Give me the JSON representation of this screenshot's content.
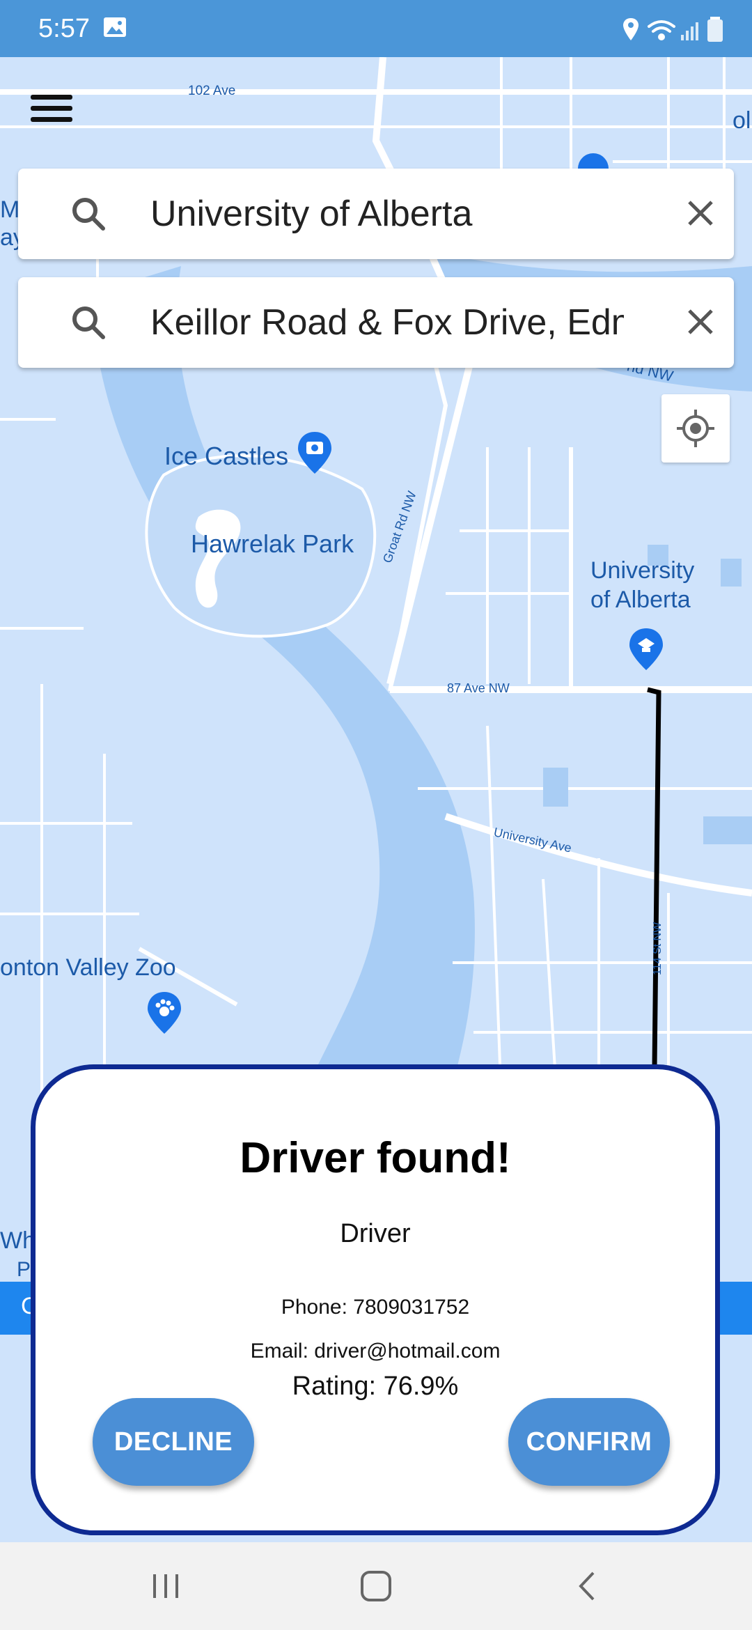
{
  "status_bar": {
    "time": "5:57"
  },
  "map": {
    "labels": {
      "ave102": "102 Ave",
      "ice_castles": "Ice Castles",
      "hawrelak_park": "Hawrelak Park",
      "groat_rd": "Groat Rd NW",
      "university_l1": "University",
      "university_l2": "of Alberta",
      "ave87": "87 Ave NW",
      "university_ave": "University Ave",
      "st114": "114 St NW",
      "valley_zoo": "onton Valley Zoo",
      "frag_ma": "Ma",
      "frag_ay": "ay",
      "frag_ol": "ol",
      "frag_nd": "nd NW",
      "frag_whi": "Whi",
      "frag_p": "P",
      "frag_c": "C"
    }
  },
  "search": {
    "origin": {
      "value": "University of Alberta"
    },
    "destination": {
      "value": "Keillor Road & Fox Drive, Edmonton"
    }
  },
  "dialog": {
    "title": "Driver found!",
    "driver_name": "Driver",
    "phone": "Phone: 7809031752",
    "email": "Email: driver@hotmail.com",
    "rating": "Rating: 76.9%",
    "decline_label": "DECLINE",
    "confirm_label": "CONFIRM"
  },
  "colors": {
    "status_bar": "#4b96d8",
    "map_land": "#cfe3fb",
    "map_water": "#a8cdf5",
    "dialog_border": "#0e2a92",
    "button": "#4b8fd6",
    "route": "#000000"
  }
}
